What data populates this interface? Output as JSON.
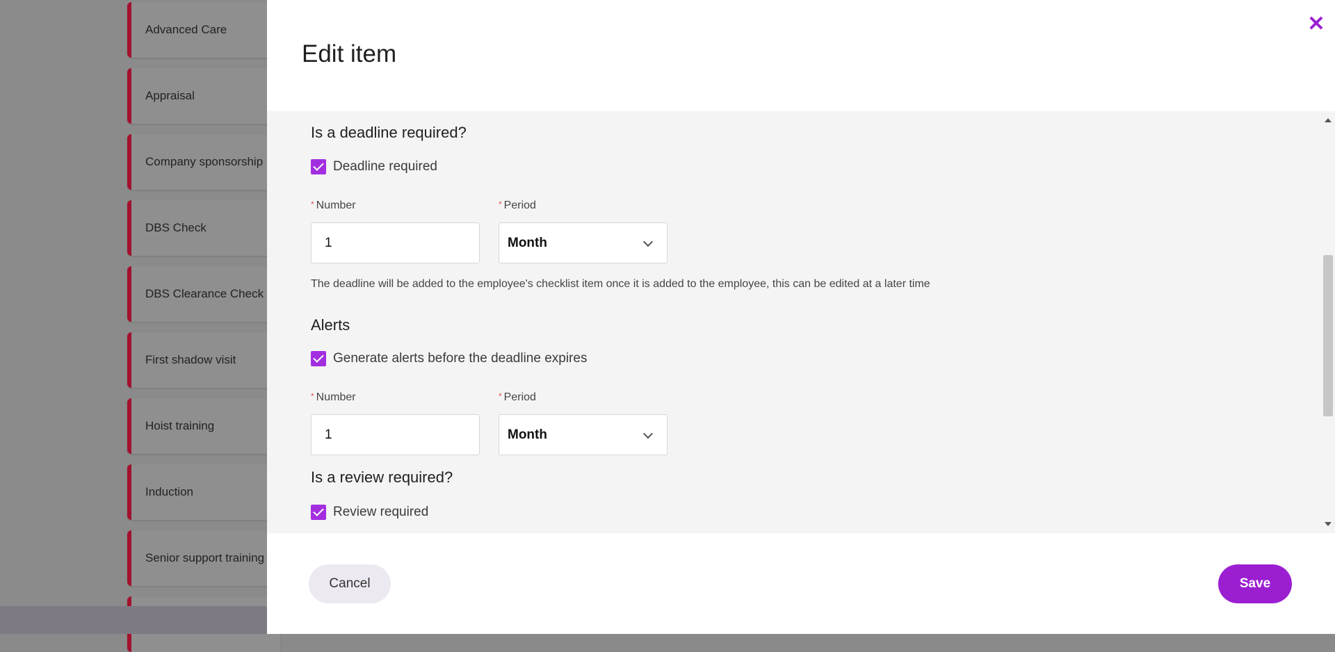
{
  "background_list": {
    "items": [
      {
        "label": "Advanced Care"
      },
      {
        "label": "Appraisal"
      },
      {
        "label": "Company sponsorship"
      },
      {
        "label": "DBS Check"
      },
      {
        "label": "DBS Clearance Check"
      },
      {
        "label": "First shadow visit"
      },
      {
        "label": "Hoist training"
      },
      {
        "label": "Induction"
      },
      {
        "label": "Senior support training"
      }
    ]
  },
  "drawer": {
    "title": "Edit item",
    "close_icon": "close-icon",
    "accent_color": "#9b1fd1"
  },
  "deadline": {
    "heading": "Is a deadline required?",
    "checkbox_label": "Deadline required",
    "checked": true,
    "number_label": "Number",
    "number_value": "1",
    "period_label": "Period",
    "period_value": "Month",
    "helper_text": "The deadline will be added to the employee's checklist item once it is added to the employee, this can be edited at a later time"
  },
  "alerts": {
    "heading": "Alerts",
    "checkbox_label": "Generate alerts before the deadline expires",
    "checked": true,
    "number_label": "Number",
    "number_value": "1",
    "period_label": "Period",
    "period_value": "Month"
  },
  "review": {
    "heading": "Is a review required?",
    "checkbox_label": "Review required",
    "checked": true
  },
  "footer": {
    "cancel_label": "Cancel",
    "save_label": "Save"
  }
}
